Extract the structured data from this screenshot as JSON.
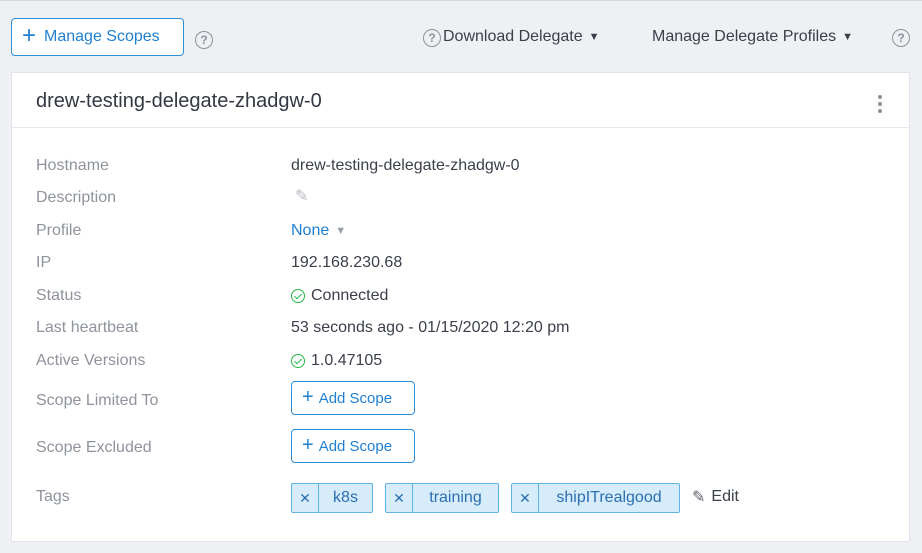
{
  "toolbar": {
    "manage_scopes_label": "Manage Scopes",
    "download_delegate_label": "Download Delegate",
    "manage_profiles_label": "Manage Delegate Profiles",
    "help_glyph": "?"
  },
  "delegate": {
    "name": "drew-testing-delegate-zhadgw-0",
    "labels": {
      "hostname": "Hostname",
      "description": "Description",
      "profile": "Profile",
      "ip": "IP",
      "status": "Status",
      "last_heartbeat": "Last heartbeat",
      "active_versions": "Active Versions",
      "scope_limited_to": "Scope Limited To",
      "scope_excluded": "Scope Excluded",
      "tags": "Tags"
    },
    "values": {
      "hostname": "drew-testing-delegate-zhadgw-0",
      "profile": "None",
      "ip": "192.168.230.68",
      "status": "Connected",
      "last_heartbeat": "53 seconds ago - 01/15/2020 12:20 pm",
      "active_versions": "1.0.47105"
    },
    "add_scope_label": "Add Scope",
    "tags": [
      "k8s",
      "training",
      "shipITrealgood"
    ],
    "edit_tags_label": "Edit"
  },
  "colors": {
    "accent": "#1f7fd1",
    "status_ok": "#27b84a",
    "tag_bg": "#d6ecfa",
    "tag_border": "#63b2e6"
  },
  "icons": [
    "plus-icon",
    "help-icon",
    "caret-down-icon",
    "kebab-menu-icon",
    "pencil-icon",
    "check-circle-icon",
    "close-icon"
  ]
}
